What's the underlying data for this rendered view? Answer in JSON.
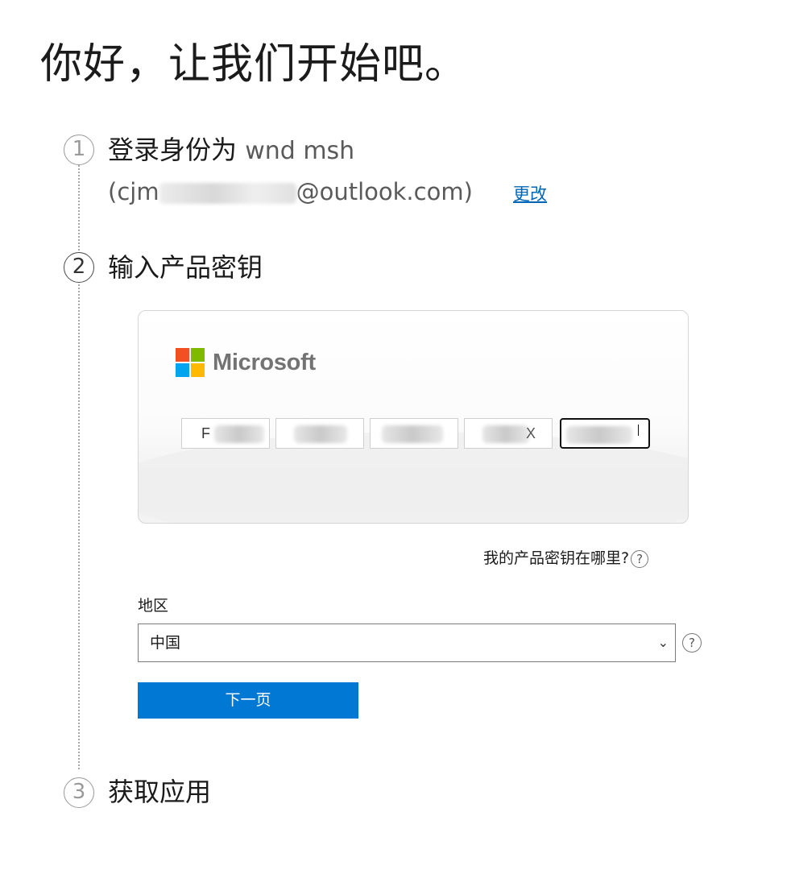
{
  "page": {
    "title": "你好，让我们开始吧。"
  },
  "steps": [
    {
      "number": "1",
      "title": "登录身份为",
      "account_name": "wnd msh",
      "account_email_prefix": "(cjm",
      "account_email_suffix": "@outlook.com)",
      "change_link": "更改"
    },
    {
      "number": "2",
      "title": "输入产品密钥"
    },
    {
      "number": "3",
      "title": "获取应用"
    }
  ],
  "product_key": {
    "brand": "Microsoft",
    "logo_colors": [
      "#f25022",
      "#7fba00",
      "#00a4ef",
      "#ffb900"
    ],
    "segments": [
      {
        "visible_text": "F"
      },
      {
        "visible_text": ""
      },
      {
        "visible_text": ""
      },
      {
        "visible_text": "X"
      },
      {
        "visible_text": ""
      }
    ],
    "where_link": "我的产品密钥在哪里?",
    "help_icon": "question-circle-icon"
  },
  "region": {
    "label": "地区",
    "selected": "中国",
    "chevron_icon": "chevron-down-icon",
    "help_icon": "question-circle-icon"
  },
  "next_button": {
    "label": "下一页"
  },
  "colors": {
    "accent": "#0078d4",
    "link": "#0067b8"
  }
}
